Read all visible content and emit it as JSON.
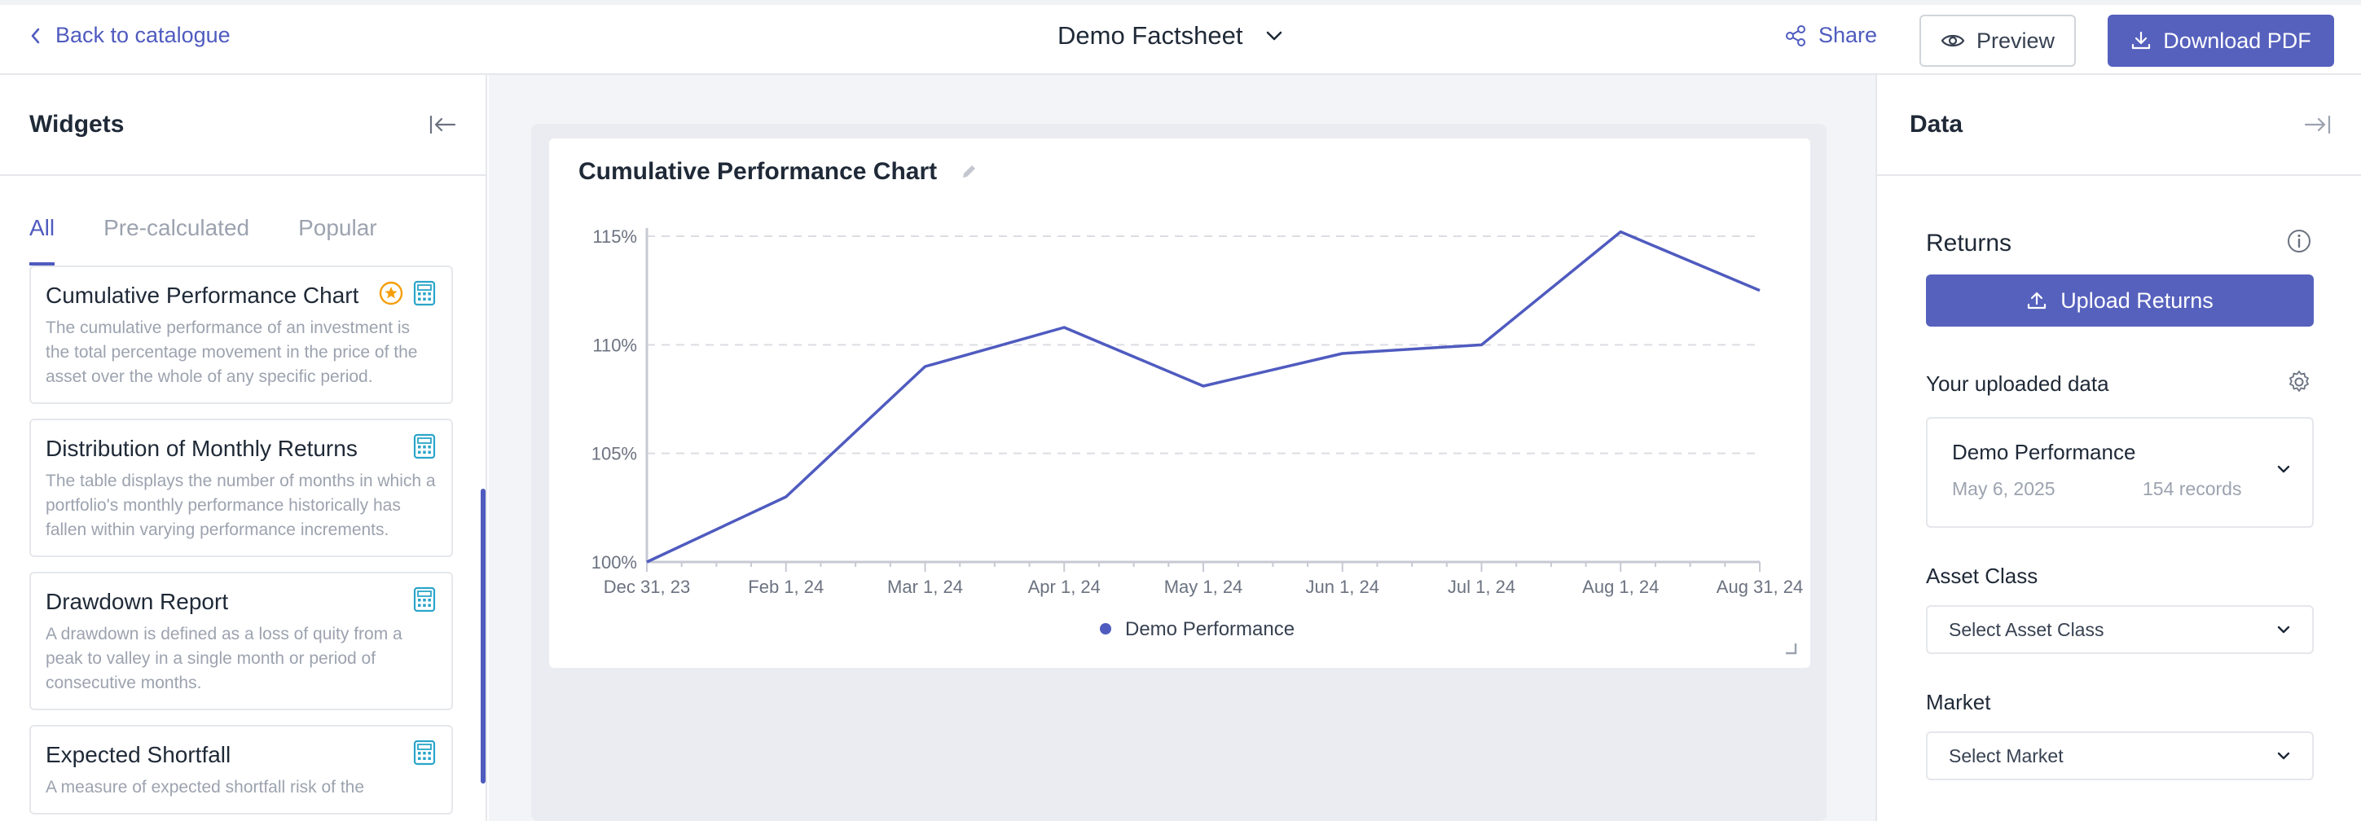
{
  "header": {
    "back_label": "Back to catalogue",
    "doc_title": "Demo Factsheet",
    "share_label": "Share",
    "preview_label": "Preview",
    "download_label": "Download PDF"
  },
  "widgets_panel": {
    "title": "Widgets",
    "tabs": [
      "All",
      "Pre-calculated",
      "Popular"
    ],
    "active_tab": "All",
    "items": [
      {
        "title": "Cumulative Performance Chart",
        "desc": "The cumulative performance of an investment is the total percentage movement in the price of the asset over the whole of any specific period.",
        "icons": [
          "star-badge-icon",
          "calculator-icon"
        ]
      },
      {
        "title": "Distribution of Monthly Returns",
        "desc": "The table displays the number of months in which a portfolio's monthly performance historically has fallen within varying performance increments.",
        "icons": [
          "calculator-icon"
        ]
      },
      {
        "title": "Drawdown Report",
        "desc": "A drawdown is defined as a loss of quity from a peak to valley in a single month or period of consecutive months.",
        "icons": [
          "calculator-icon"
        ]
      },
      {
        "title": "Expected Shortfall",
        "desc": "A measure of expected shortfall risk of the",
        "icons": [
          "calculator-icon"
        ]
      }
    ]
  },
  "chart_card": {
    "title": "Cumulative Performance Chart"
  },
  "chart_data": {
    "type": "line",
    "title": "Cumulative Performance Chart",
    "x": [
      "Dec 31, 23",
      "Feb 1, 24",
      "Mar 1, 24",
      "Apr 1, 24",
      "May 1, 24",
      "Jun 1, 24",
      "Jul 1, 24",
      "Aug 1, 24",
      "Aug 31, 24"
    ],
    "x_ticks": [
      "Dec 31, 23",
      "Feb 1, 24",
      "Mar 1, 24",
      "Apr 1, 24",
      "May 1, 24",
      "Jun 1, 24",
      "Jul 1, 24",
      "Aug 1, 24",
      "Aug 31, 24"
    ],
    "y_ticks": [
      "100%",
      "105%",
      "110%",
      "115%"
    ],
    "ylim": [
      100,
      115
    ],
    "series": [
      {
        "name": "Demo Performance",
        "color": "#4f5bbf",
        "values": [
          100,
          103.0,
          109.0,
          110.8,
          108.1,
          109.6,
          110.0,
          115.2,
          112.5
        ]
      }
    ],
    "grid": "horizontal dashed",
    "legend": "bottom-center"
  },
  "data_panel": {
    "title": "Data",
    "returns_title": "Returns",
    "upload_label": "Upload Returns",
    "uploaded_label": "Your uploaded data",
    "dataset": {
      "name": "Demo Performance",
      "date": "May 6, 2025",
      "records": "154 records"
    },
    "asset_class_label": "Asset Class",
    "asset_class_value": "Select Asset Class",
    "market_label": "Market",
    "market_value": "Select Market"
  },
  "colors": {
    "accent": "#5661bd",
    "link": "#4f5bbf",
    "star": "#f59e0b",
    "calc": "#2aa5c9"
  }
}
